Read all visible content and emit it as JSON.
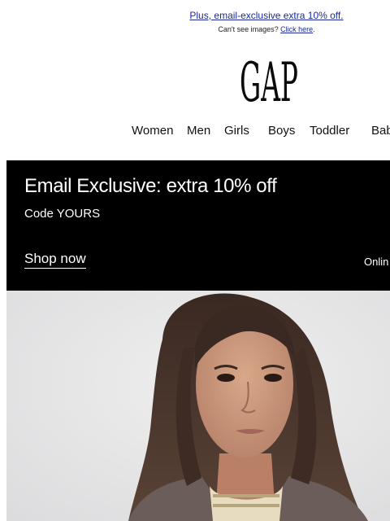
{
  "preheader": {
    "offer_link": "Plus, email-exclusive extra 10% off.",
    "cant_see_text": "Can't see images?",
    "click_here": "Click here",
    "period": "."
  },
  "brand": {
    "logo_text": "GAP"
  },
  "nav": {
    "items": [
      "Women",
      "Men",
      "Girls",
      "Boys",
      "Toddler",
      "Bab"
    ]
  },
  "promo": {
    "title": "Email Exclusive: extra 10% off",
    "code": "Code YOURS",
    "cta": "Shop now",
    "side_text": "Onlin",
    "background": "#000000",
    "text_color": "#ffffff"
  },
  "hero": {
    "image_icon": "girl-portrait-photo"
  },
  "colors": {
    "link": "#1a2a9a",
    "page_bg": "#ffffff"
  }
}
